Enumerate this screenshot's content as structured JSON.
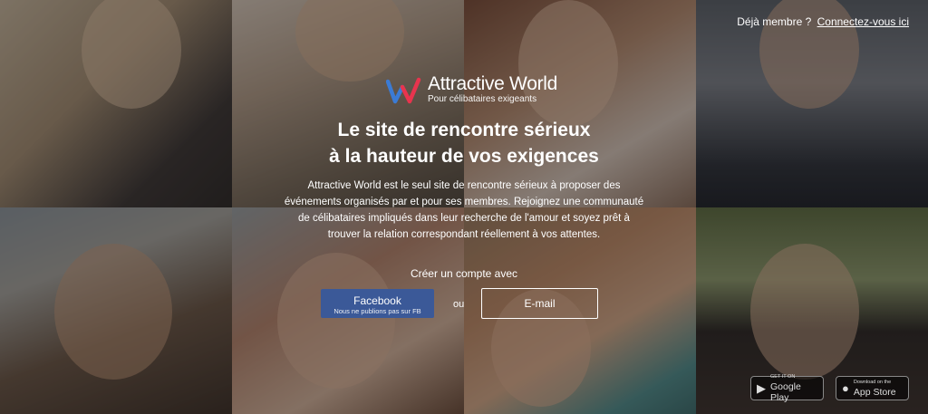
{
  "header": {
    "already_member": "Déjà membre ?",
    "login_link": "Connectez-vous ici"
  },
  "logo": {
    "name": "Attractive World",
    "tagline": "Pour célibataires exigeants"
  },
  "hero": {
    "headline_line1": "Le site de rencontre sérieux",
    "headline_line2": "à la hauteur de vos exigences",
    "description": "Attractive World est le seul site de rencontre sérieux à proposer des événements organisés par et pour ses membres. Rejoignez une communauté de célibataires impliqués dans leur recherche de l'amour et soyez prêt à trouver la relation correspondant réellement à vos attentes."
  },
  "signup": {
    "label": "Créer un compte avec",
    "facebook_label": "Facebook",
    "facebook_note": "Nous ne publions pas sur FB",
    "or_label": "ou",
    "email_label": "E-mail"
  },
  "stores": {
    "google_small": "GET IT ON",
    "google_big": "Google Play",
    "apple_small": "Download on the",
    "apple_big": "App Store"
  },
  "colors": {
    "facebook_blue": "#3b5998",
    "logo_red": "#e8344e",
    "logo_blue": "#3b7bd4"
  }
}
